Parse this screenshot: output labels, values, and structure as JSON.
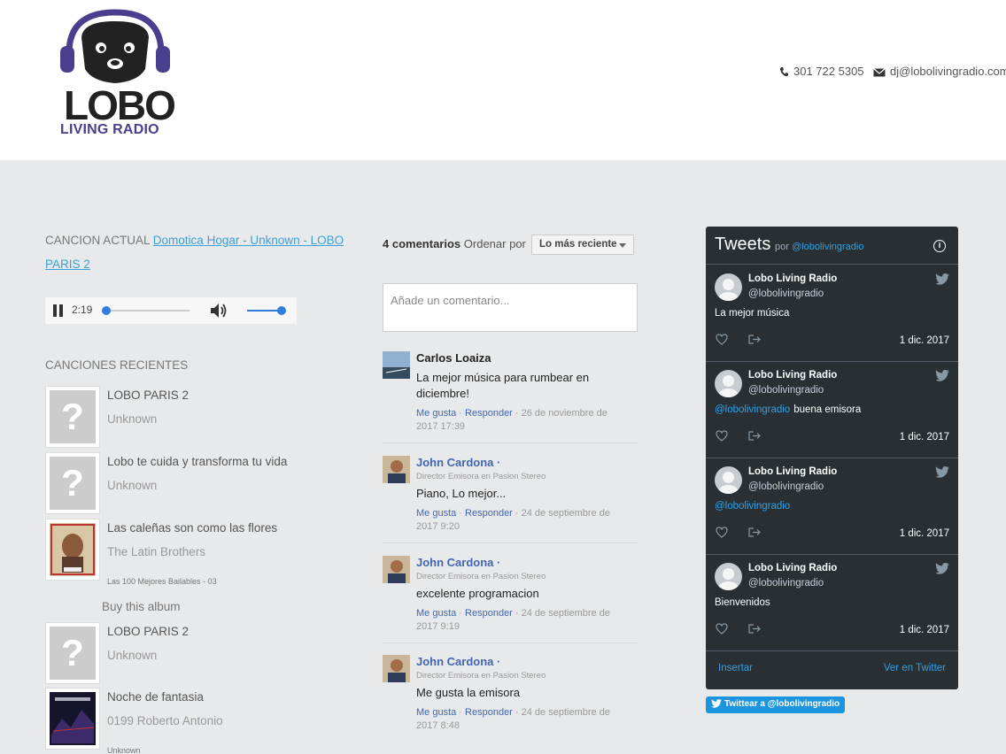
{
  "header": {
    "logo_word": "LOBO",
    "logo_sub": "LIVING RADIO",
    "phone": "301 722 5305",
    "email": "dj@lobolivingradio.com"
  },
  "now_playing": {
    "label": "CANCION ACTUAL",
    "link": "Domotica Hogar - Unknown - LOBO PARIS 2",
    "time": "2:19",
    "progress": 0.0,
    "volume": 0.85
  },
  "recent": {
    "title": "CANCIONES RECIENTES",
    "buy_label": "Buy this album",
    "songs": [
      {
        "title": "LOBO PARIS 2",
        "artist": "Unknown",
        "album": ""
      },
      {
        "title": "Lobo te cuida y transforma tu vida",
        "artist": "Unknown",
        "album": ""
      },
      {
        "title": "Las caleñas son como las flores",
        "artist": "The Latin Brothers",
        "album": "Las 100 Mejores Bailables - 03"
      },
      {
        "title": "LOBO PARIS 2",
        "artist": "Unknown",
        "album": ""
      },
      {
        "title": "Noche de fantasia",
        "artist": "0199 Roberto Antonio",
        "album": "Unknown"
      }
    ],
    "placeholder_glyph": "?"
  },
  "comments": {
    "count_label": "4 comentarios",
    "sort_label": "Ordenar por",
    "sort_value": "Lo más reciente",
    "input_placeholder": "Añade un comentario...",
    "like": "Me gusta",
    "reply": "Responder",
    "items": [
      {
        "name": "Carlos Loaiza",
        "role": "",
        "text": "La mejor música para rumbear en diciembre!",
        "date": "26 de noviembre de 2017 17:39"
      },
      {
        "name": "John Cardona",
        "role": "Director Emisora en Pasion Stereo",
        "text": "Piano, Lo mejor...",
        "date": "24 de septiembre de 2017 9:20"
      },
      {
        "name": "John Cardona",
        "role": "Director Emisora en Pasion Stereo",
        "text": "excelente programacion",
        "date": "24 de septiembre de 2017 9:19"
      },
      {
        "name": "John Cardona",
        "role": "Director Emisora en Pasion Stereo",
        "text": "Me gusta la emisora",
        "date": "24 de septiembre de 2017 8:48"
      }
    ]
  },
  "twitter": {
    "title": "Tweets",
    "by": "por",
    "handle": "@lobolivingradio",
    "insert": "Insertar",
    "view": "Ver en Twitter",
    "follow": "Twittear a @lobolivingradio",
    "tweets": [
      {
        "name": "Lobo Living Radio",
        "handle": "@lobolivingradio",
        "mention": "",
        "text": "La mejor música",
        "date": "1 dic. 2017"
      },
      {
        "name": "Lobo Living Radio",
        "handle": "@lobolivingradio",
        "mention": "@lobolivingradio",
        "text": "buena emisora",
        "date": "1 dic. 2017"
      },
      {
        "name": "Lobo Living Radio",
        "handle": "@lobolivingradio",
        "mention": "@lobolivingradio",
        "text": "",
        "date": "1 dic. 2017"
      },
      {
        "name": "Lobo Living Radio",
        "handle": "@lobolivingradio",
        "mention": "",
        "text": "Bienvenidos",
        "date": "1 dic. 2017"
      }
    ]
  },
  "colors": {
    "link": "#3aa0d8",
    "twitter_bg": "#292f33",
    "twitter_blue": "#1b95e0",
    "facebook_blue": "#4267b2",
    "logo_purple": "#4a3f8f"
  }
}
